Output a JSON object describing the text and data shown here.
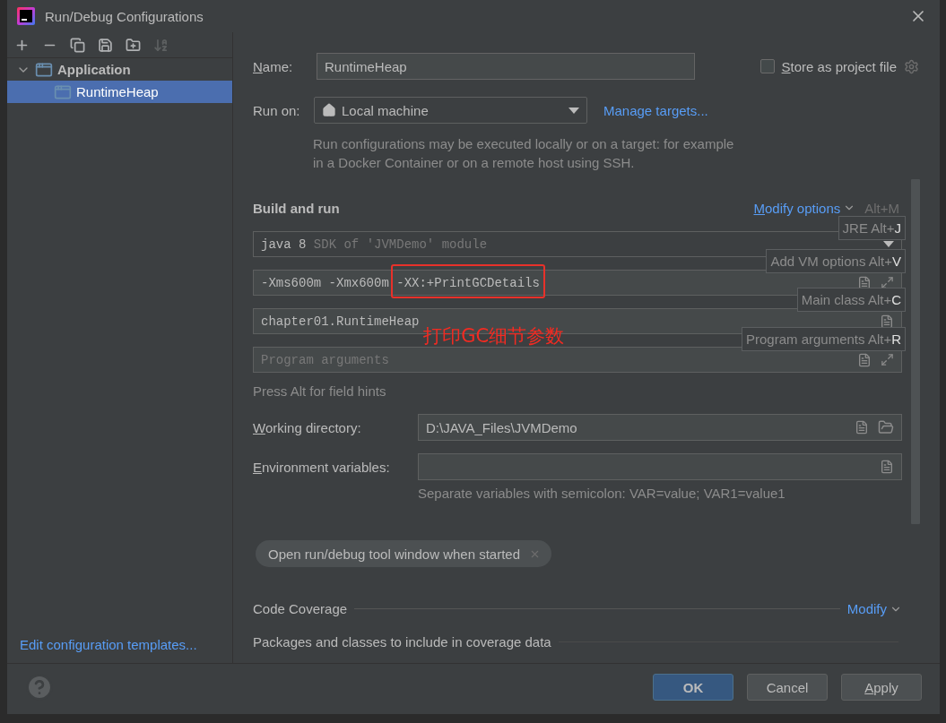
{
  "window": {
    "title": "Run/Debug Configurations"
  },
  "toolbar": [
    {
      "kind": "add",
      "disabled": false
    },
    {
      "kind": "remove",
      "disabled": false
    },
    {
      "kind": "copy",
      "disabled": false
    },
    {
      "kind": "save",
      "disabled": false
    },
    {
      "kind": "folder",
      "disabled": false
    },
    {
      "kind": "sort",
      "disabled": true
    }
  ],
  "tree": [
    {
      "label": "Application",
      "expanded": true,
      "selected": false,
      "children": [
        {
          "label": "RuntimeHeap",
          "selected": true
        }
      ]
    }
  ],
  "edit_templates_link": "Edit configuration templates...",
  "name_field": {
    "label": "Name:",
    "mnemonic": true,
    "value": "RuntimeHeap"
  },
  "store_as_project_file": {
    "label": "Store as project file",
    "mnemonic": true,
    "checked": false
  },
  "run_on": {
    "label": "Run on:",
    "value": "Local machine",
    "link": "Manage targets...",
    "description": "Run configurations may be executed locally or on a target: for example in a Docker Container or on a remote host using SSH."
  },
  "build_and_run": {
    "title": "Build and run",
    "modify_options": "Modify options",
    "shortcut": "Alt+M",
    "jre": {
      "value": "java 8",
      "hint": "SDK of 'JVMDemo' module"
    },
    "vm_options": [
      {
        "text": "-Xms600m -Xmx600m ",
        "highlighted": false
      },
      {
        "text": "-XX:+PrintGCDetails",
        "highlighted": true
      }
    ],
    "annotation": "打印GC细节参数",
    "main_class": "chapter01.RuntimeHeap",
    "program_arguments": {
      "placeholder": "Program arguments"
    },
    "note": "Press Alt for field hints",
    "hints": [
      {
        "text": "JRE Alt+**J**"
      },
      {
        "text": "Add VM options Alt+**V**"
      },
      {
        "text": "Main class Alt+**C**"
      },
      {
        "text": "Program arguments Alt+**R**"
      }
    ]
  },
  "working_directory": {
    "label": "Working directory:",
    "mnemonic": true,
    "value": "D:\\JAVA_Files\\JVMDemo"
  },
  "environment_variables": {
    "label": "Environment variables:",
    "mnemonic": true,
    "note": "Separate variables with semicolon: VAR=value; VAR1=value1"
  },
  "chip": {
    "label": "Open run/debug tool window when started"
  },
  "code_coverage": {
    "title": "Code Coverage",
    "link": "Modify",
    "packages_label": "Packages and classes to include in coverage data"
  },
  "buttons": [
    {
      "label": "OK",
      "kind": "default",
      "mnemonic": false
    },
    {
      "label": "Cancel",
      "kind": "normal",
      "mnemonic": false
    },
    {
      "label": "Apply",
      "kind": "normal",
      "mnemonic": true
    }
  ]
}
